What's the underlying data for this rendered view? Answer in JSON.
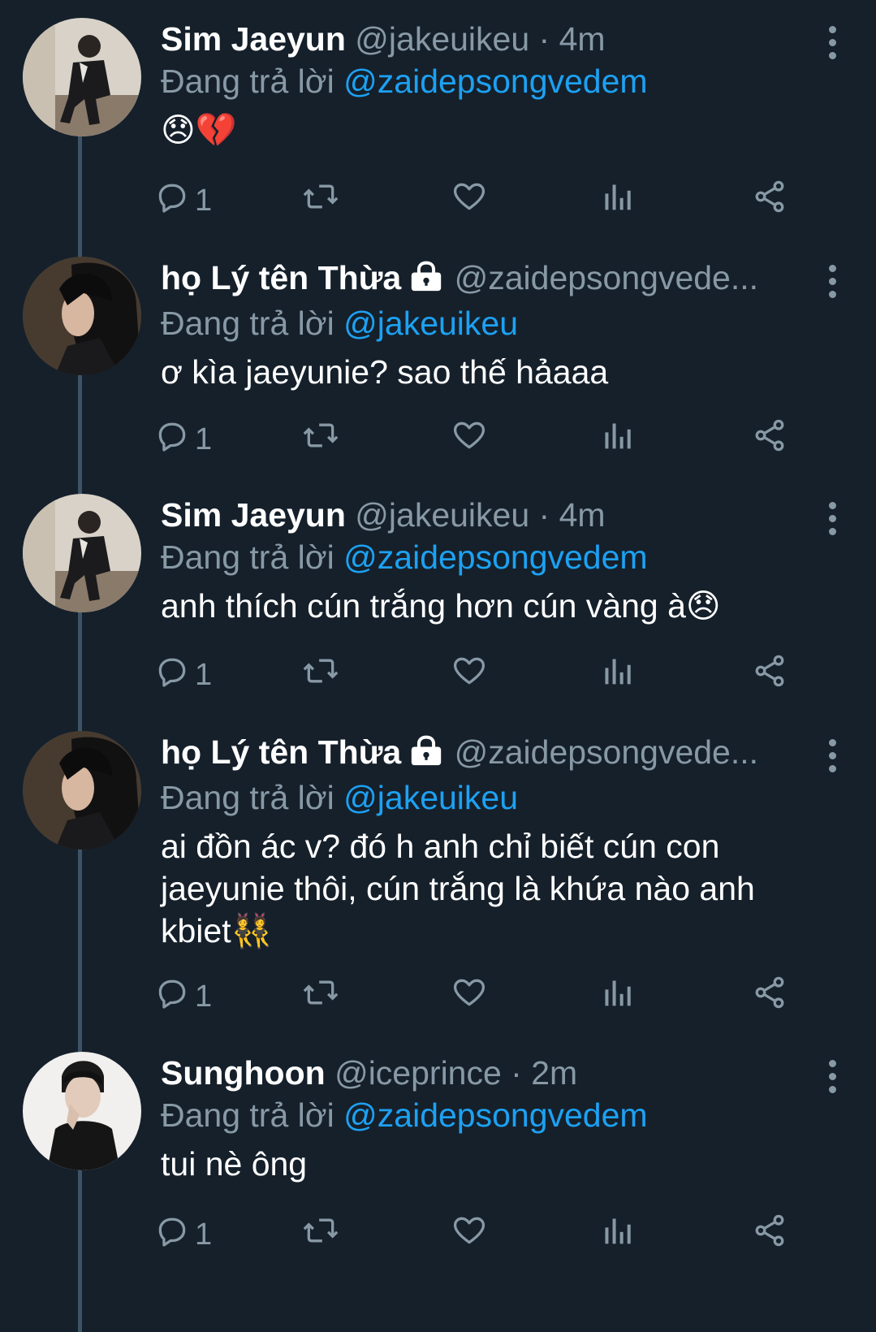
{
  "tweets": [
    {
      "name": "Sim Jaeyun",
      "handle": "@jakeuikeu · 4m",
      "reply_prefix": "Đang trả lời",
      "reply_to": "@zaidepsongvedem",
      "text": "😞💔",
      "reply_count": "1",
      "locked": false,
      "avatar": "avatar-jaeyun"
    },
    {
      "name": "họ Lý tên Thừa",
      "handle": "@zaidepsongvede...",
      "reply_prefix": "Đang trả lời",
      "reply_to": "@jakeuikeu",
      "text": "ơ kìa jaeyunie? sao thế hảaaa",
      "reply_count": "1",
      "locked": true,
      "avatar": "avatar-thua"
    },
    {
      "name": "Sim Jaeyun",
      "handle": "@jakeuikeu · 4m",
      "reply_prefix": "Đang trả lời",
      "reply_to": "@zaidepsongvedem",
      "text": "anh thích cún trắng hơn cún vàng à😞",
      "reply_count": "1",
      "locked": false,
      "avatar": "avatar-jaeyun"
    },
    {
      "name": "họ Lý tên Thừa",
      "handle": "@zaidepsongvede...",
      "reply_prefix": "Đang trả lời",
      "reply_to": "@jakeuikeu",
      "text": "ai đồn ác v? đó h anh chỉ biết cún con jaeyunie thôi, cún trắng là khứa nào anh kbiet👯",
      "reply_count": "1",
      "locked": true,
      "avatar": "avatar-thua"
    },
    {
      "name": "Sunghoon",
      "handle": "@iceprince · 2m",
      "reply_prefix": "Đang trả lời",
      "reply_to": "@zaidepsongvedem",
      "text": "tui nè ông",
      "reply_count": "1",
      "locked": false,
      "avatar": "avatar-sunghoon"
    }
  ],
  "icons": {
    "reply": "reply-icon",
    "retweet": "retweet-icon",
    "like": "heart-icon",
    "analytics": "analytics-icon",
    "share": "share-icon",
    "more": "more-icon",
    "lock": "lock-icon"
  },
  "colors": {
    "background": "#15202b",
    "muted": "#8899a6",
    "mention": "#1da1f2",
    "thread_line": "#3d5466"
  }
}
